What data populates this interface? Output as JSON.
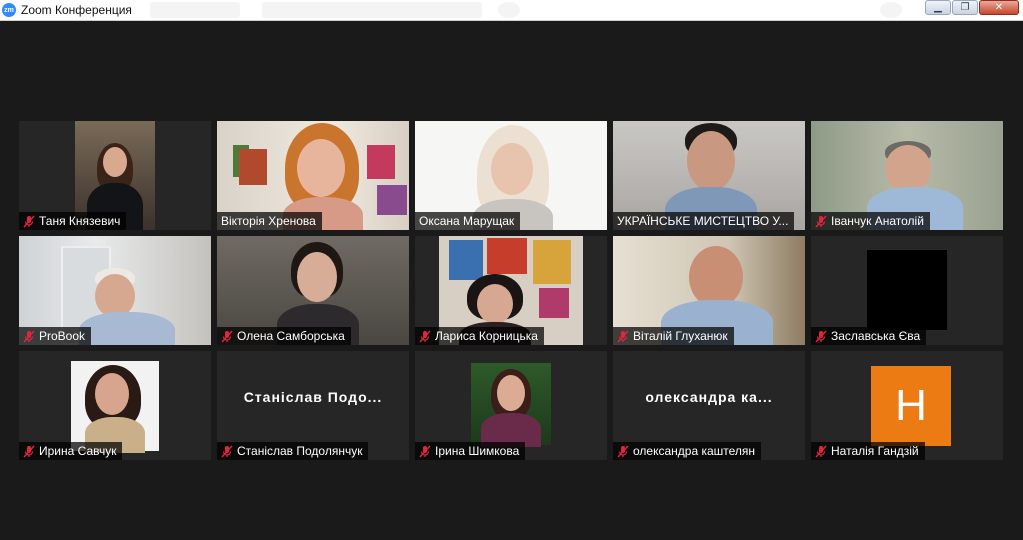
{
  "window": {
    "title": "Zoom Конференция",
    "logo_text": "zm",
    "minimize_glyph": "▁",
    "restore_glyph": "❐",
    "close_glyph": "✕"
  },
  "colors": {
    "active_speaker_border": "#c5e05b",
    "muted_mic": "#e0253d",
    "avatar_orange": "#ec7b13"
  },
  "participants": [
    {
      "name": "Таня Князевич",
      "muted": true
    },
    {
      "name": "Вікторія Хренова",
      "muted": false
    },
    {
      "name": "Оксана Марущак",
      "muted": false
    },
    {
      "name": "УКРАЇНСЬКЕ МИСТЕЦТВО У...",
      "muted": false,
      "active_speaker": true
    },
    {
      "name": "Іванчук Анатолій",
      "muted": true
    },
    {
      "name": "ProBook",
      "muted": true
    },
    {
      "name": "Олена Самборська",
      "muted": true
    },
    {
      "name": "Лариса Корницька",
      "muted": true
    },
    {
      "name": "Віталій Глуханюк",
      "muted": true
    },
    {
      "name": "Заславська Єва",
      "muted": true
    },
    {
      "name": "Ирина Савчук",
      "muted": true
    },
    {
      "name": "Станіслав Подолянчук",
      "muted": true,
      "video_off_label": "Станіслав Подо..."
    },
    {
      "name": "Ірина Шимкова",
      "muted": true
    },
    {
      "name": "олександра каштелян",
      "muted": true,
      "video_off_label": "олександра ка..."
    },
    {
      "name": "Наталія Гандзій",
      "muted": true,
      "avatar_letter": "H"
    }
  ]
}
